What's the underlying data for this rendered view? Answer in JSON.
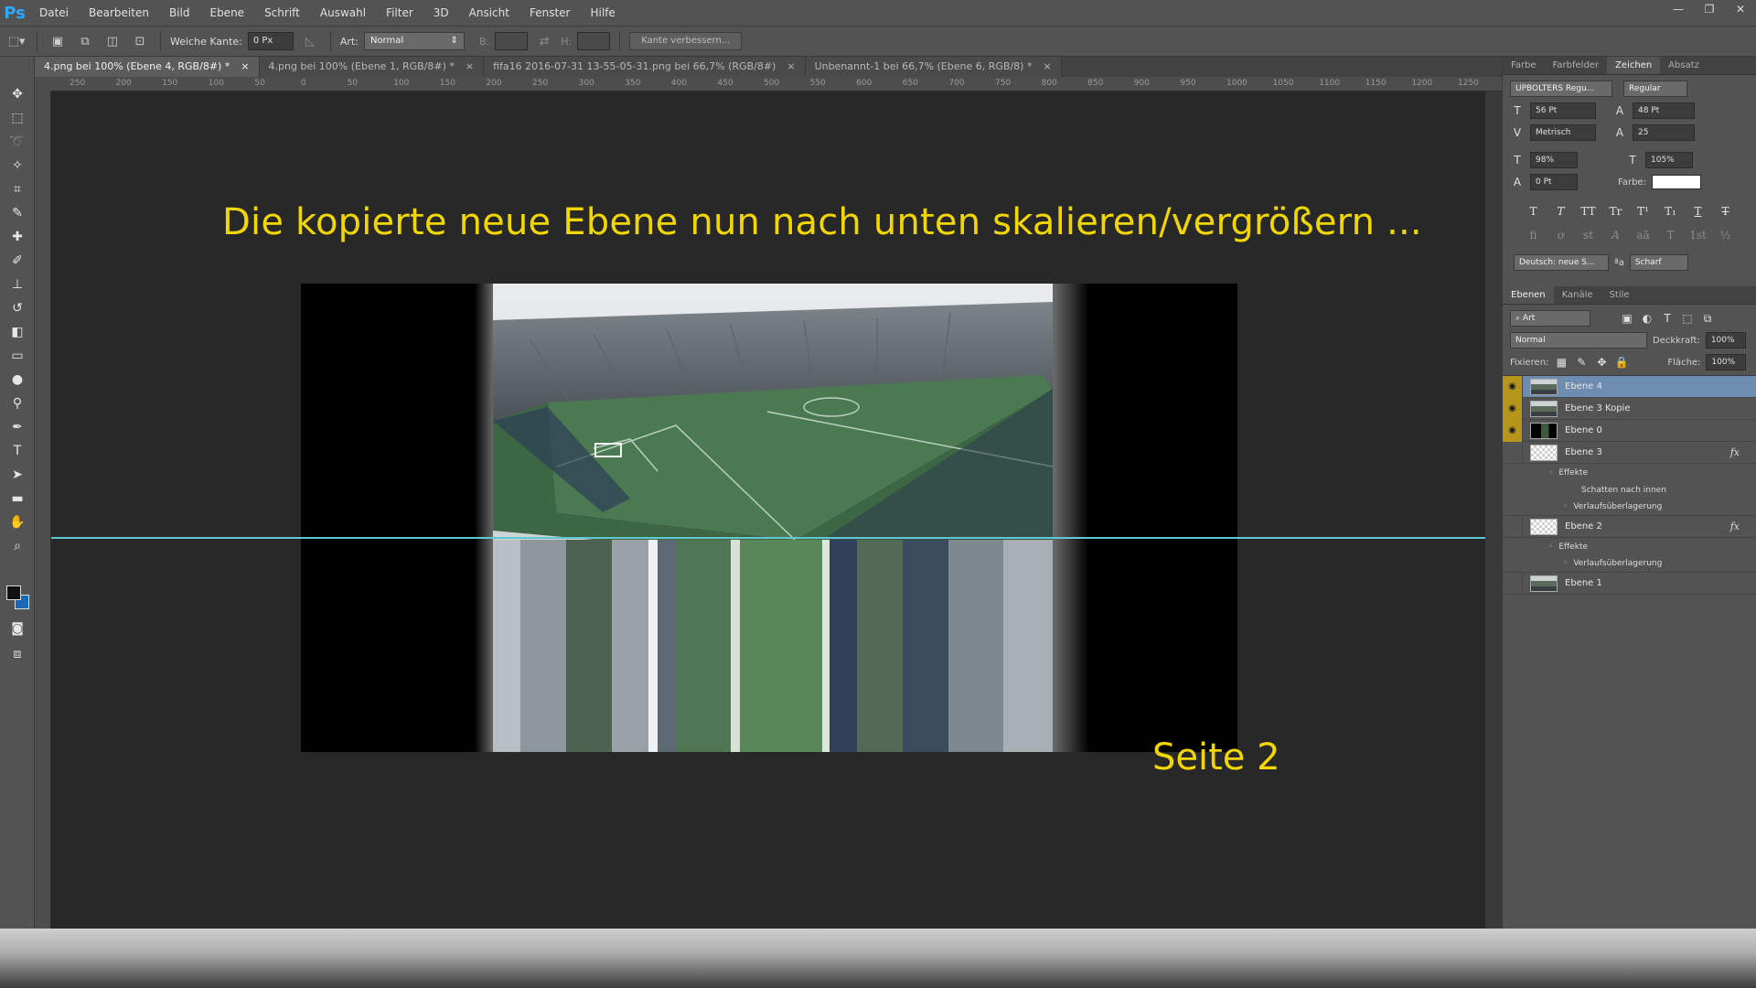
{
  "app": {
    "logo": "Ps"
  },
  "menu": [
    "Datei",
    "Bearbeiten",
    "Bild",
    "Ebene",
    "Schrift",
    "Auswahl",
    "Filter",
    "3D",
    "Ansicht",
    "Fenster",
    "Hilfe"
  ],
  "window_controls": [
    "—",
    "❐",
    "✕"
  ],
  "options": {
    "feather_label": "Weiche Kante:",
    "feather_value": "0 Px",
    "style_label": "Art:",
    "style_value": "Normal",
    "width_label": "B:",
    "height_label": "H:",
    "refine_button": "Kante verbessern..."
  },
  "tabs": [
    {
      "label": "4.png bei 100% (Ebene 4, RGB/8#) *",
      "close": "×"
    },
    {
      "label": "4.png bei 100% (Ebene 1, RGB/8#) *",
      "close": "×"
    },
    {
      "label": "fifa16 2016-07-31 13-55-05-31.png bei 66,7% (RGB/8#)",
      "close": "×"
    },
    {
      "label": "Unbenannt-1 bei 66,7% (Ebene 6, RGB/8) *",
      "close": "×"
    }
  ],
  "ruler_labels": [
    "250",
    "200",
    "150",
    "100",
    "50",
    "0",
    "50",
    "100",
    "150",
    "200",
    "250",
    "300",
    "350",
    "400",
    "450",
    "500",
    "550",
    "600",
    "650",
    "700",
    "750",
    "800",
    "850",
    "900",
    "950",
    "1000",
    "1050",
    "1100",
    "1150",
    "1200",
    "1250"
  ],
  "canvas": {
    "headline": "Die kopierte neue Ebene nun nach unten skalieren/vergrößern ...",
    "page_label": "Seite 2"
  },
  "character_panel": {
    "tabs": [
      "Farbe",
      "Farbfelder",
      "Zeichen",
      "Absatz"
    ],
    "active_tab": "Zeichen",
    "font_family": "UPBOLTERS Regu...",
    "font_style": "Regular",
    "font_size": "56 Pt",
    "leading": "48 Pt",
    "kerning": "Metrisch",
    "tracking": "25",
    "vertical_scale": "98%",
    "horizontal_scale": "105%",
    "baseline_shift": "0 Pt",
    "color_label": "Farbe:",
    "color_value": "#ffffff",
    "type_buttons_row1": [
      "T",
      "T",
      "TT",
      "Tr",
      "T¹",
      "T₁",
      "T",
      "T"
    ],
    "type_buttons_row2": [
      "fi",
      "ơ",
      "st",
      "A",
      "aā",
      "T",
      "1st",
      "½"
    ],
    "language": "Deutsch: neue S...",
    "aa_label": "ªa",
    "antialias": "Scharf"
  },
  "layers_panel": {
    "tabs": [
      "Ebenen",
      "Kanäle",
      "Stile"
    ],
    "active_tab": "Ebenen",
    "filter": "Art",
    "blend_mode": "Normal",
    "opacity_label": "Deckkraft:",
    "opacity_value": "100%",
    "lock_label": "Fixieren:",
    "fill_label": "Fläche:",
    "fill_value": "100%",
    "effects_label": "Effekte",
    "layers": [
      {
        "name": "Ebene 4",
        "visible": true,
        "selected": true,
        "thumb": "stad"
      },
      {
        "name": "Ebene 3 Kopie",
        "visible": true,
        "selected": false,
        "thumb": "stad"
      },
      {
        "name": "Ebene 0",
        "visible": true,
        "selected": false,
        "thumb": "dark"
      },
      {
        "name": "Ebene 3",
        "visible": false,
        "selected": false,
        "thumb": "chk",
        "fx": "fx",
        "effects": [
          "Schatten nach innen",
          "Verlaufsüberlagerung"
        ]
      },
      {
        "name": "Ebene 2",
        "visible": false,
        "selected": false,
        "thumb": "chk",
        "fx": "fx",
        "effects": [
          "Verlaufsüberlagerung"
        ]
      },
      {
        "name": "Ebene 1",
        "visible": false,
        "selected": false,
        "thumb": "stad"
      }
    ]
  },
  "colors": {
    "foreground": "#111111",
    "background": "#1a68b5",
    "accent_text": "#f2d600",
    "guide": "#5fc8d1",
    "selected_layer": "#6e8bb0",
    "visibility_on": "#b6961a"
  }
}
